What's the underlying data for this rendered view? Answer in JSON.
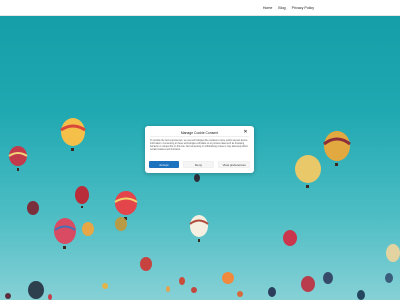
{
  "nav": {
    "items": [
      {
        "label": "Home"
      },
      {
        "label": "Blog"
      },
      {
        "label": "Privacy Policy"
      }
    ]
  },
  "hero": {
    "colors": {
      "sky_top": "#159ea7",
      "sky_bottom": "#86d1d6"
    },
    "image_subject": "hot-air-balloons"
  },
  "cookie_banner": {
    "title": "Manage Cookie Consent",
    "body": "To provide the best experiences, we use technologies like cookies to store and/or access device information. Consenting to these technologies will allow us to process data such as browsing behavior or unique IDs on this site. Not consenting or withdrawing consent, may adversely affect certain features and functions.",
    "close_icon": "close-icon",
    "accept_label": "Accept",
    "deny_label": "Deny",
    "preferences_label": "View preferences",
    "accent_color": "#1e73be"
  }
}
